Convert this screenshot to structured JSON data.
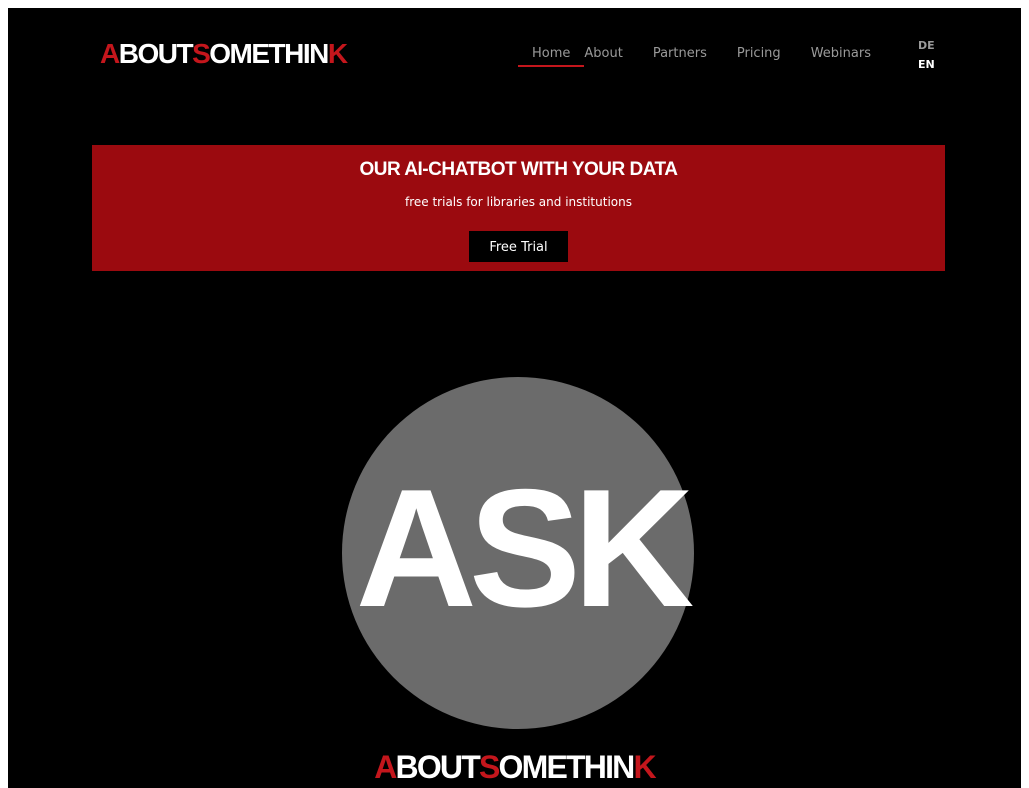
{
  "colors": {
    "accent": "#c4161c",
    "banner": "#9b0a0f",
    "background": "#000000",
    "circle": "#6b6b6b"
  },
  "header": {
    "logo": {
      "parts": [
        "A",
        "BOUT",
        "S",
        "OMETHIN",
        "K"
      ]
    },
    "nav": {
      "home": "Home",
      "about": "About",
      "partners": "Partners",
      "pricing": "Pricing",
      "webinars": "Webinars",
      "active": "Home"
    },
    "languages": {
      "de": "DE",
      "en": "EN",
      "selected": "EN"
    }
  },
  "banner": {
    "title": "OUR AI-CHATBOT WITH YOUR DATA",
    "subtitle": "free trials for libraries and institutions",
    "button_label": "Free Trial"
  },
  "hero": {
    "graphic_text": "ASK",
    "brand": {
      "parts": [
        "A",
        "BOUT",
        "S",
        "OMETHIN",
        "K"
      ]
    }
  }
}
